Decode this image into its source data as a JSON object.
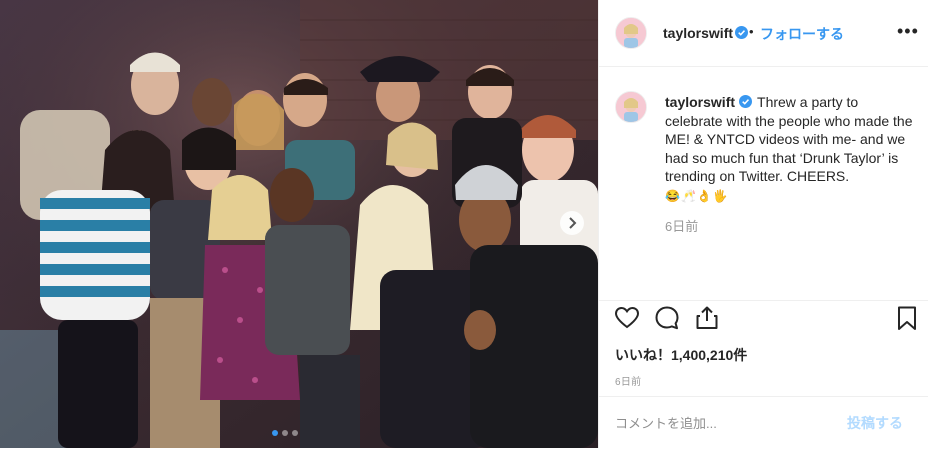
{
  "post": {
    "photo_alt": "",
    "carousel": {
      "total_slides": 3,
      "active_index": 0
    }
  },
  "header": {
    "username": "taylorswift",
    "separator": "•",
    "follow_label": "フォローする",
    "more_label": "•••"
  },
  "caption": {
    "username": "taylorswift",
    "text": "Threw a party to celebrate with the people who made the ME! & YNTCD videos with me- and we had so much fun that ‘Drunk Taylor’ is trending on Twitter. CHEERS.",
    "emojis": "😂🥂👌🖐",
    "time": "6日前"
  },
  "actions": {
    "like_icon": "heart-icon",
    "comment_icon": "comment-icon",
    "share_icon": "share-icon",
    "save_icon": "bookmark-icon"
  },
  "likes": {
    "text": "いいね！1,400,210件"
  },
  "posted_time": "6日前",
  "comment": {
    "placeholder": "コメントを追加...",
    "post_label": "投稿する"
  },
  "colors": {
    "accent": "#3897f0",
    "post_disabled": "#b3dbff",
    "verified": "#3897f0"
  }
}
